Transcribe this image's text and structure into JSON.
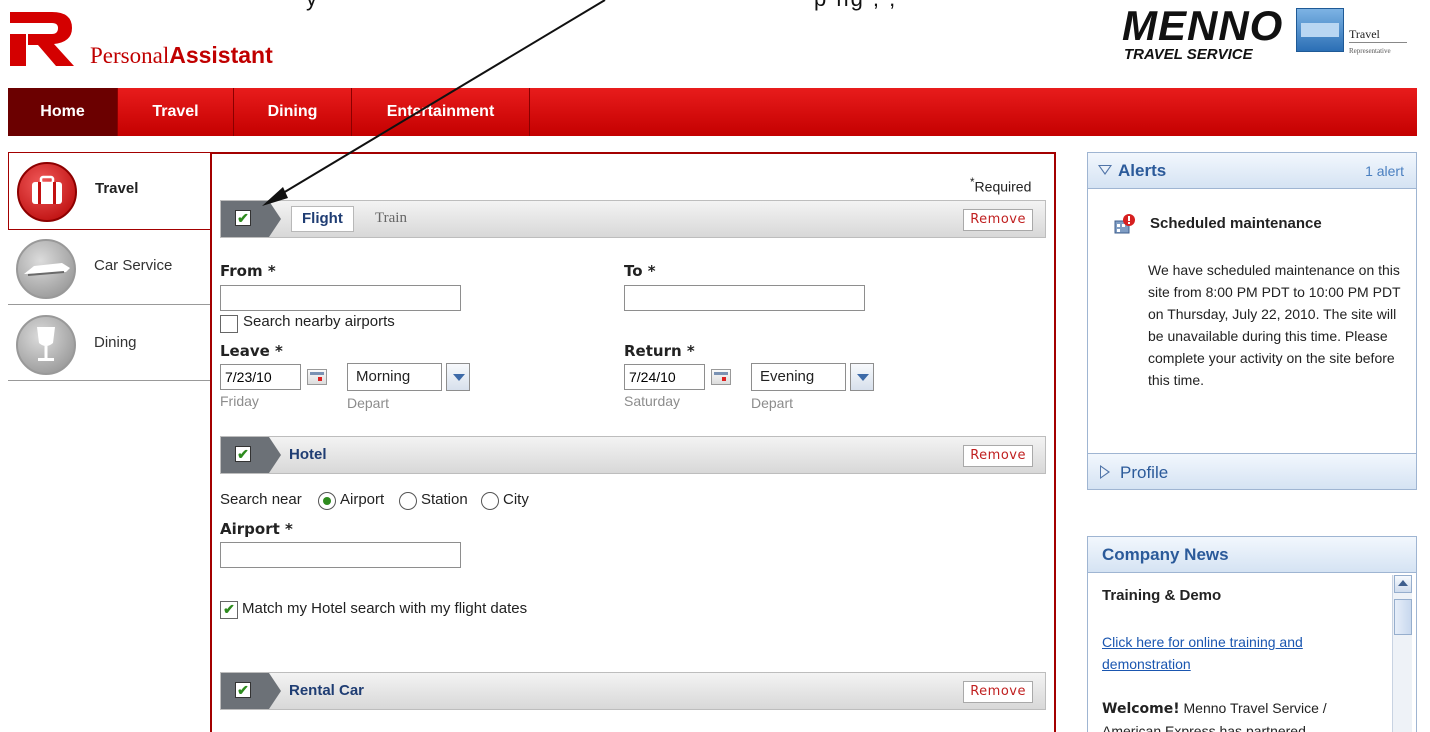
{
  "header": {
    "brand_regular": "Personal",
    "brand_bold": "Assistant",
    "cutoff_text_left": "y",
    "cutoff_text_right": "p  ng  ,      ,",
    "partner_name": "MENNO",
    "partner_sub": "TRAVEL SERVICE",
    "partner_rep_line1": "Travel",
    "partner_rep_line2": "Representative"
  },
  "nav": {
    "tabs": [
      {
        "label": "Home"
      },
      {
        "label": "Travel"
      },
      {
        "label": "Dining"
      },
      {
        "label": "Entertainment"
      }
    ]
  },
  "sidebar": {
    "items": [
      {
        "label": "Travel",
        "icon": "suitcase-icon"
      },
      {
        "label": "Car Service",
        "icon": "car-icon"
      },
      {
        "label": "Dining",
        "icon": "wine-glass-icon"
      }
    ]
  },
  "form": {
    "required_note": "Required",
    "required_star": "*",
    "flight": {
      "tab_flight": "Flight",
      "tab_train": "Train",
      "remove_label": "Remove",
      "check": "✔",
      "from_label": "From *",
      "from_value": "",
      "to_label": "To *",
      "to_value": "",
      "nearby_label": "Search nearby airports",
      "leave_label": "Leave *",
      "leave_date": "7/23/10",
      "leave_day": "Friday",
      "leave_time": "Morning",
      "leave_time_label": "Depart",
      "return_label": "Return *",
      "return_date": "7/24/10",
      "return_day": "Saturday",
      "return_time": "Evening",
      "return_time_label": "Depart"
    },
    "hotel": {
      "title": "Hotel",
      "remove_label": "Remove",
      "check": "✔",
      "search_near_label": "Search near",
      "options": [
        "Airport",
        "Station",
        "City"
      ],
      "selected": "Airport",
      "airport_label": "Airport *",
      "airport_value": "",
      "match_label": "Match my Hotel search with my flight dates",
      "match_check": "✔"
    },
    "rental": {
      "title": "Rental Car",
      "remove_label": "Remove",
      "check": "✔"
    }
  },
  "alerts": {
    "title": "Alerts",
    "count": "1 alert",
    "item_title": "Scheduled maintenance",
    "item_body": "We have scheduled maintenance on this site from 8:00 PM PDT to 10:00 PM PDT on Thursday, July 22, 2010. The site will be unavailable during this time. Please complete your activity on the site before this time.",
    "profile_label": "Profile"
  },
  "news": {
    "title": "Company News",
    "subtitle": "Training & Demo",
    "link": "Click here for online training and demonstration",
    "welcome_bold": "Welcome!",
    "welcome_text": " Menno Travel Service / American Express has partnered"
  },
  "colors": {
    "brand_red": "#c00000",
    "nav_active": "#6b0000",
    "link_blue": "#1a56b0",
    "check_green": "#2e8b1e"
  }
}
